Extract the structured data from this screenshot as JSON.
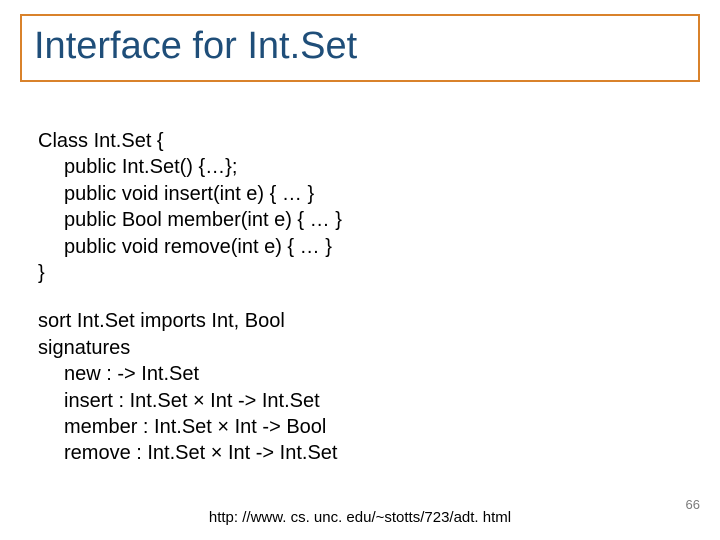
{
  "title": "Interface for Int.Set",
  "code1": {
    "l1": "Class Int.Set {",
    "l2": "public Int.Set() {…};",
    "l3": "public void insert(int e) { … }",
    "l4": "public Bool member(int e) { … }",
    "l5": "public void remove(int e) { … }",
    "l6": "}"
  },
  "code2": {
    "l1": "sort Int.Set imports Int, Bool",
    "l2": "signatures",
    "l3": "new : -> Int.Set",
    "l4": "insert : Int.Set × Int -> Int.Set",
    "l5": "member : Int.Set × Int -> Bool",
    "l6": "remove : Int.Set × Int -> Int.Set"
  },
  "footer_url": "http: //www. cs. unc. edu/~stotts/723/adt. html",
  "page_number": "66"
}
